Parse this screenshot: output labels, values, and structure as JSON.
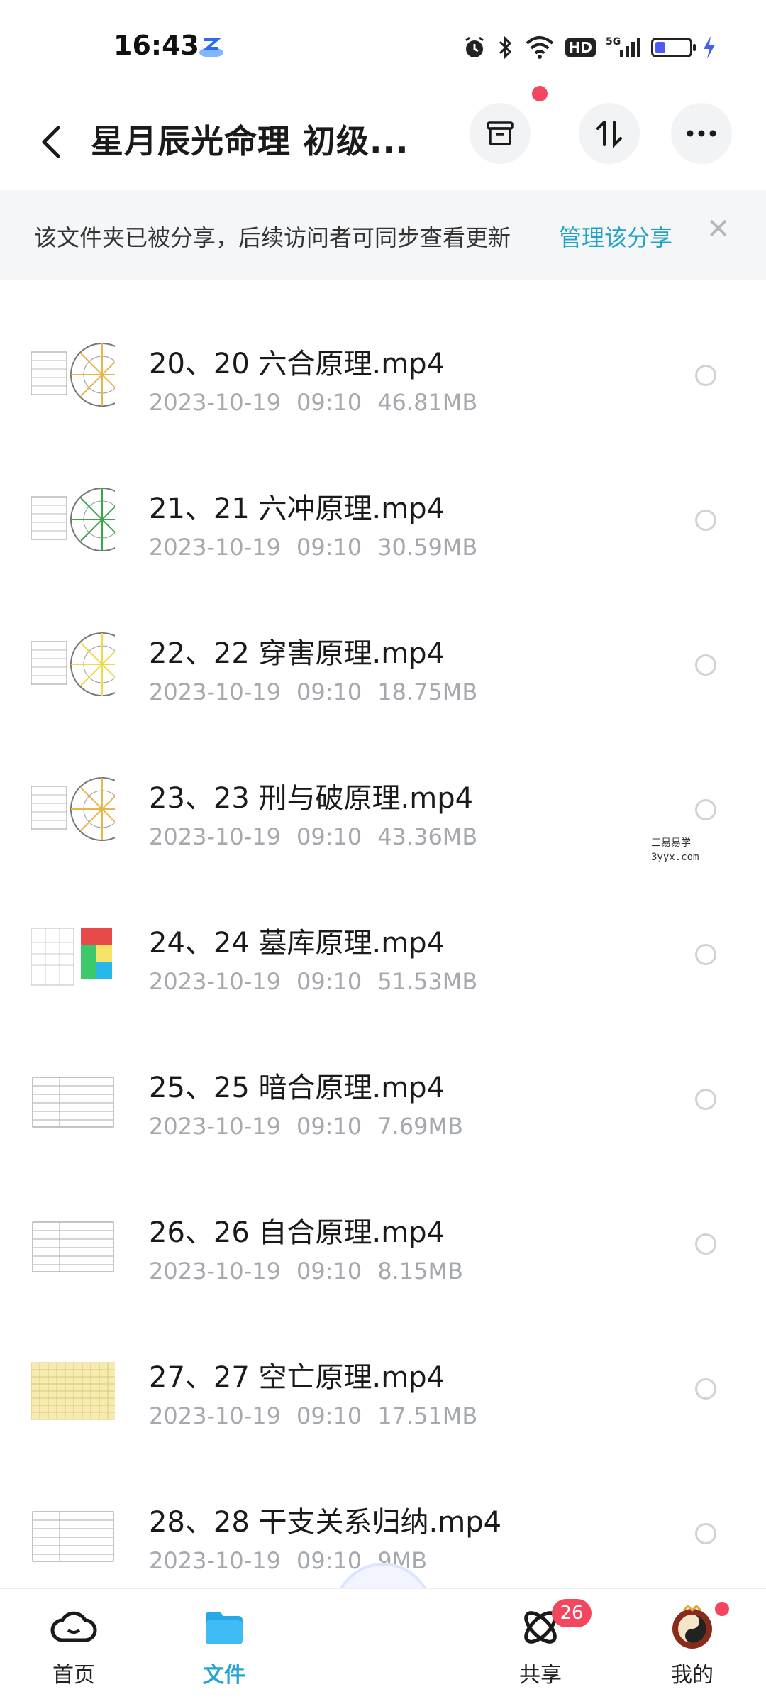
{
  "status_bar": {
    "time": "16:43",
    "network": "5G",
    "hd_label": "HD",
    "battery_level": 0.3
  },
  "header": {
    "title": "星月辰光命理 初级..."
  },
  "share_banner": {
    "text": "该文件夹已被分享，后续访问者可同步查看更新",
    "link": "管理该分享"
  },
  "files": [
    {
      "name": "20、20 六合原理.mp4",
      "date": "2023-10-19",
      "time": "09:10",
      "size": "46.81MB",
      "thumb": "wheel"
    },
    {
      "name": "21、21 六冲原理.mp4",
      "date": "2023-10-19",
      "time": "09:10",
      "size": "30.59MB",
      "thumb": "wheel-green"
    },
    {
      "name": "22、22 穿害原理.mp4",
      "date": "2023-10-19",
      "time": "09:10",
      "size": "18.75MB",
      "thumb": "wheel-yellow"
    },
    {
      "name": "23、23 刑与破原理.mp4",
      "date": "2023-10-19",
      "time": "09:10",
      "size": "43.36MB",
      "thumb": "wheel"
    },
    {
      "name": "24、24 墓库原理.mp4",
      "date": "2023-10-19",
      "time": "09:10",
      "size": "51.53MB",
      "thumb": "color-grid"
    },
    {
      "name": "25、25 暗合原理.mp4",
      "date": "2023-10-19",
      "time": "09:10",
      "size": "7.69MB",
      "thumb": "table"
    },
    {
      "name": "26、26 自合原理.mp4",
      "date": "2023-10-19",
      "time": "09:10",
      "size": "8.15MB",
      "thumb": "table"
    },
    {
      "name": "27、27 空亡原理.mp4",
      "date": "2023-10-19",
      "time": "09:10",
      "size": "17.51MB",
      "thumb": "yellow-table"
    },
    {
      "name": "28、28 干支关系归纳.mp4",
      "date": "2023-10-19",
      "time": "09:10",
      "size": "9MB",
      "thumb": "table"
    }
  ],
  "watermark": {
    "line1": "三易易学",
    "line2": "3yyx.com"
  },
  "bottom_nav": {
    "home": "首页",
    "files": "文件",
    "share": "共享",
    "share_badge": "26",
    "me": "我的"
  },
  "colors": {
    "accent": "#2aa4d5",
    "badge": "#f4475f",
    "link": "#1fa3c8"
  }
}
